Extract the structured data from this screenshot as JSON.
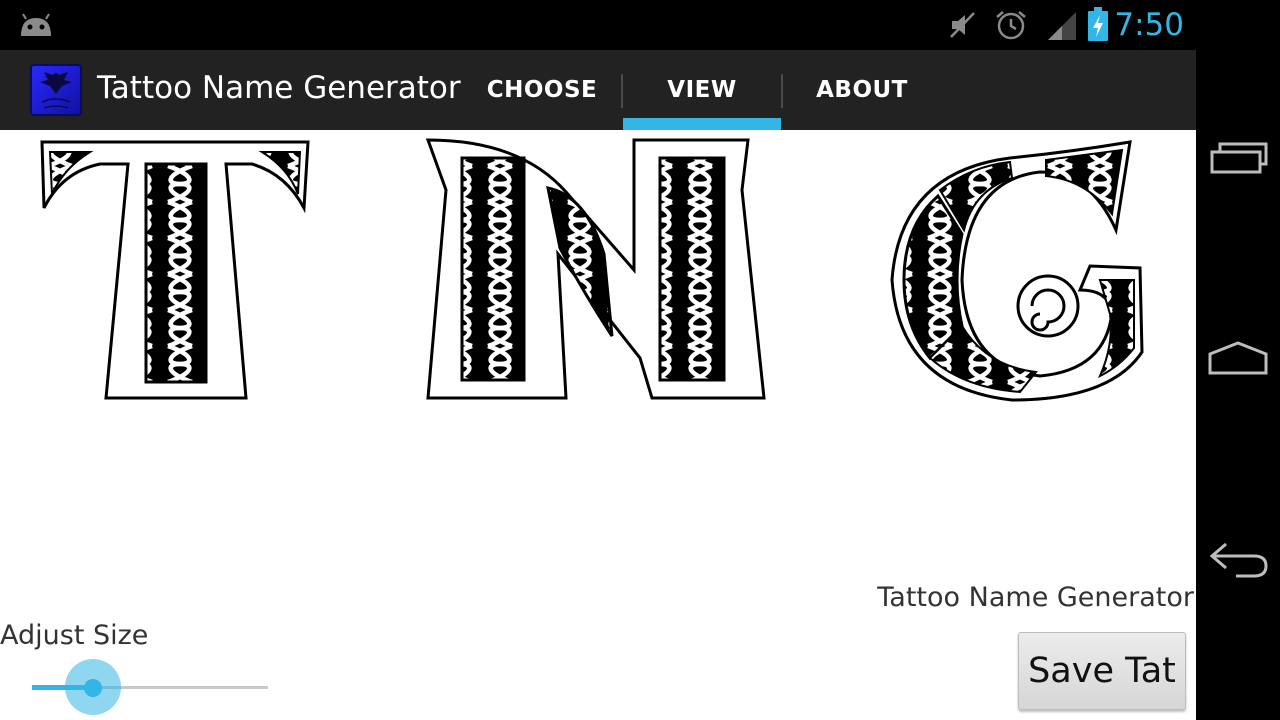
{
  "status_bar": {
    "time": "7:50"
  },
  "action_bar": {
    "title": "Tattoo Name Generator",
    "tabs": [
      {
        "label": "CHOOSE",
        "selected": false
      },
      {
        "label": "VIEW",
        "selected": true
      },
      {
        "label": "ABOUT",
        "selected": false
      }
    ]
  },
  "canvas": {
    "letters": [
      "T",
      "N",
      "G"
    ]
  },
  "controls": {
    "caption": "Tattoo Name Generator",
    "adjust_label": "Adjust Size",
    "slider_value": 0.26,
    "save_label": "Save Tat"
  },
  "colors": {
    "accent": "#33b5e5",
    "action_bar": "#222222",
    "app_icon": "#2a2aff"
  }
}
